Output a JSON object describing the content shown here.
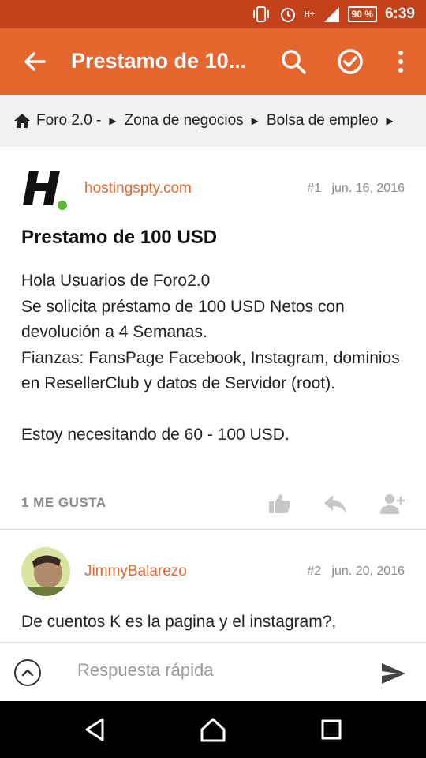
{
  "status_bar": {
    "time": "6:39",
    "battery": "90 %",
    "network": "H+"
  },
  "toolbar": {
    "title": "Prestamo de 10...",
    "color": "#e5662f"
  },
  "breadcrumb": [
    {
      "label": "Foro 2.0 -"
    },
    {
      "label": "Zona de negocios"
    },
    {
      "label": "Bolsa de empleo"
    }
  ],
  "posts": [
    {
      "author": "hostingspty.com",
      "number": "#1",
      "date": "jun. 16, 2016",
      "title": "Prestamo de 100 USD",
      "body": [
        "Hola Usuarios de Foro2.0",
        "Se solicita préstamo de 100 USD Netos con devolución a 4 Semanas.",
        "Fianzas: FansPage Facebook, Instagram, dominios en ResellerClub y datos de Servidor (root).",
        "",
        "Estoy necesitando de 60 - 100 USD."
      ],
      "likes": "1 ME GUSTA"
    },
    {
      "author": "JimmyBalarezo",
      "number": "#2",
      "date": "jun. 20, 2016",
      "body": [
        "De cuentos K es la pagina y el instagram?,"
      ]
    }
  ],
  "reply": {
    "placeholder": "Respuesta rápida"
  },
  "icons": [
    "back-arrow-icon",
    "search-icon",
    "check-circle-icon",
    "more-vert-icon",
    "home-icon",
    "thumb-up-icon",
    "reply-icon",
    "add-person-icon",
    "expand-up-icon",
    "send-icon",
    "nav-back-icon",
    "nav-home-icon",
    "nav-recents-icon"
  ]
}
